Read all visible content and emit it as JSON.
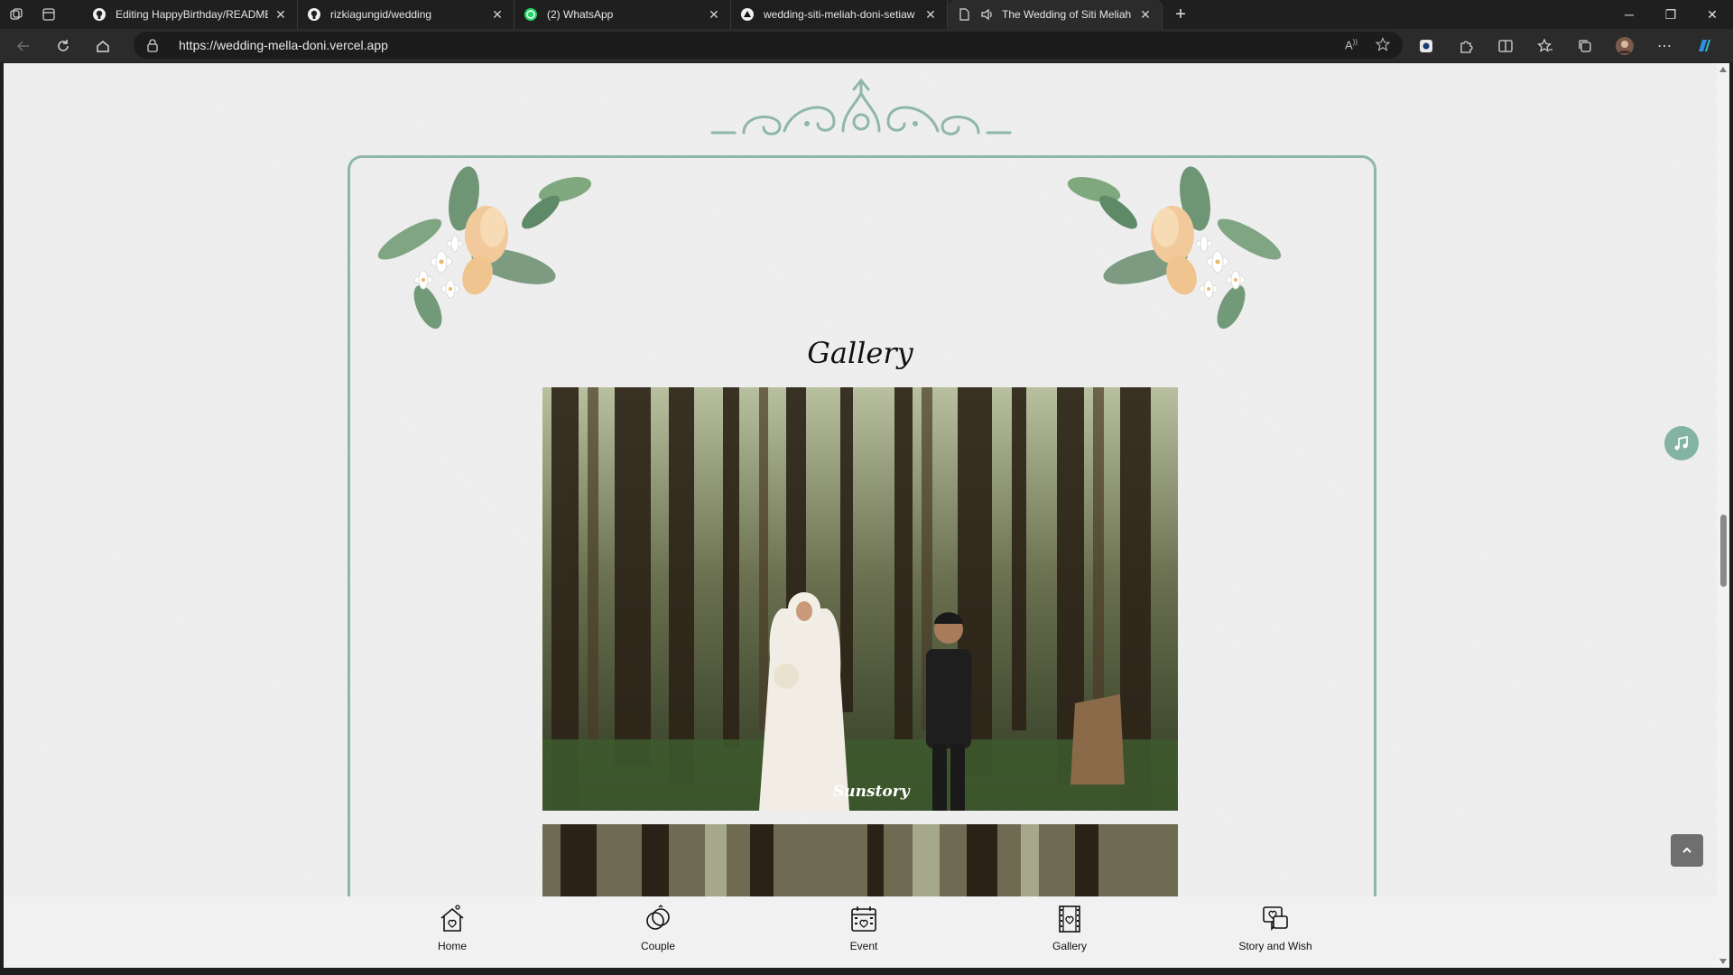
{
  "browser": {
    "tabs": [
      {
        "label": "Editing HappyBirthday/README",
        "icon": "github-icon"
      },
      {
        "label": "rizkiagungid/wedding",
        "icon": "github-icon"
      },
      {
        "label": "(2) WhatsApp",
        "icon": "whatsapp-icon"
      },
      {
        "label": "wedding-siti-meliah-doni-setiaw",
        "icon": "vercel-icon"
      },
      {
        "label": "The Wedding of Siti Meliah",
        "icon": "page-icon"
      }
    ],
    "url": "https://wedding-mella-doni.vercel.app"
  },
  "page": {
    "section_title": "Gallery",
    "photo_watermark": "Sunstory",
    "accent_color": "#8fb7a8",
    "nav": [
      {
        "label": "Home",
        "icon": "home-icon"
      },
      {
        "label": "Couple",
        "icon": "rings-icon"
      },
      {
        "label": "Event",
        "icon": "calendar-icon"
      },
      {
        "label": "Gallery",
        "icon": "film-heart-icon"
      },
      {
        "label": "Story and Wish",
        "icon": "chat-heart-icon"
      }
    ]
  }
}
